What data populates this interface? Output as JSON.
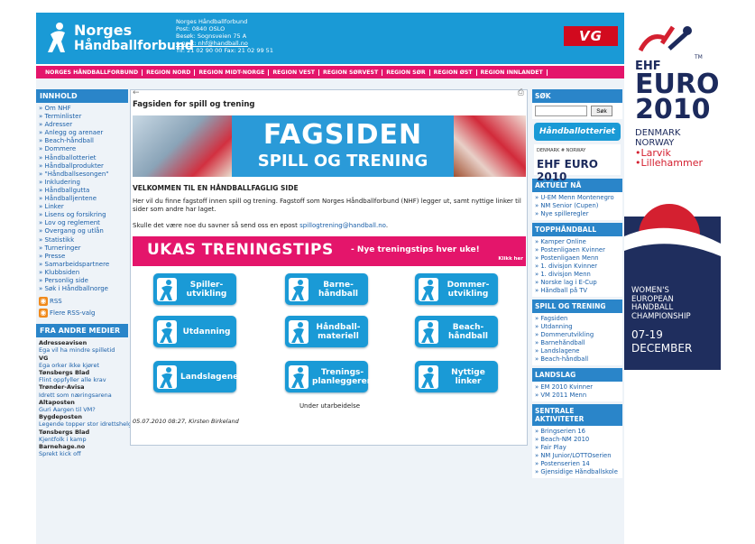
{
  "header": {
    "logo_line1": "Norges",
    "logo_line2": "Håndballforbund",
    "address": [
      "Norges Håndballforbund",
      "Post: 0840 OSLO",
      "Besøk: Sognsveien 75 A",
      "e-post: nhf@handball.no",
      "Tlf: 21 02 90 00 Fax: 21 02 99 51"
    ],
    "vg_logo": "VG"
  },
  "nav": [
    "NORGES HÅNDBALLFORBUND",
    "REGION NORD",
    "REGION MIDT-NORGE",
    "REGION VEST",
    "REGION SØRVEST",
    "REGION SØR",
    "REGION ØST",
    "REGION INNLANDET"
  ],
  "left": {
    "heading": "INNHOLD",
    "links": [
      "Om NHF",
      "Terminlister",
      "Adresser",
      "Anlegg og arenaer",
      "Beach-håndball",
      "Dommere",
      "Håndballotteriet",
      "Håndballprodukter",
      "\"Håndballsesongen\"",
      "Inkludering",
      "Håndballgutta",
      "Håndballjentene",
      "Linker",
      "Lisens og forsikring",
      "Lov og reglement",
      "Overgang og utlån",
      "Statistikk",
      "Turneringer",
      "Presse",
      "Samarbeidspartnere",
      "Klubbsiden",
      "Personlig side",
      "Søk i Håndballnorge"
    ],
    "rss": "RSS",
    "rss_more": "Flere RSS-valg",
    "media_heading": "FRA ANDRE MEDIER",
    "media": [
      {
        "source": "Adresseavisen",
        "title": "Ega vil ha mindre spilletid"
      },
      {
        "source": "VG",
        "title": "Ega orker ikke kjøret"
      },
      {
        "source": "Tønsbergs Blad",
        "title": "Flint oppfyller alle krav"
      },
      {
        "source": "Trønder-Avisa",
        "title": "Idrett som næringsarena"
      },
      {
        "source": "Altaposten",
        "title": "Guri Aargen til VM?"
      },
      {
        "source": "Bygdeposten",
        "title": "Legende topper stor idrettshelg"
      },
      {
        "source": "Tønsbergs Blad",
        "title": "Kjentfolk i kamp"
      },
      {
        "source": "Barnehage.no",
        "title": "Sprekt kick off"
      }
    ]
  },
  "main": {
    "back_icon": "←",
    "print_icon": "⎙",
    "title": "Fagsiden for spill og trening",
    "banner_line1": "FAGSIDEN",
    "banner_line2": "SPILL OG TRENING",
    "heading": "VELKOMMEN TIL EN HÅNDBALLFAGLIG SIDE",
    "intro": "Her vil du finne fagstoff innen spill og trening. Fagstoff som Norges Håndballforbund (NHF) legger ut, samt nyttige linker til sider som andre har laget.",
    "more_prefix": "Skulle det være noe du savner så send oss en epost ",
    "more_email": "spillogtrening@handball.no",
    "more_suffix": ".",
    "ukas_title": "UKAS TRENINGSTIPS",
    "ukas_sub": "- Nye treningstips hver uke!",
    "ukas_click": "Klikk her",
    "tiles": [
      "Spiller-\nutvikling",
      "Barne-\nhåndball",
      "Dommer-\nutvikling",
      "Utdanning",
      "Håndball-\nmateriell",
      "Beach-\nhåndball",
      "Landslagene",
      "Trenings-\nplanleggeren",
      "Nyttige\nlinker"
    ],
    "under": "Under utarbeidelse",
    "signature": "05.07.2010 08:27, Kirsten Birkeland"
  },
  "right": {
    "search_heading": "SØK",
    "search_button": "Søk",
    "lotto": "Håndballotteriet",
    "ehf_small_top": "DENMARK # NORWAY",
    "ehf_small_main": "EHF EURO 2010",
    "aktuelt_heading": "AKTUELT NÅ",
    "aktuelt": [
      "U-EM Menn Montenegro",
      "NM Senior (Cupen)",
      "Nye spilleregler"
    ],
    "topp_heading": "TOPPHÅNDBALL",
    "topp": [
      "Kamper Online",
      "Postenligaen Kvinner",
      "Postenligaen Menn",
      "1. divisjon Kvinner",
      "1. divisjon Menn",
      "Norske lag i E-Cup",
      "Håndball på TV"
    ],
    "spill_heading": "SPILL OG TRENING",
    "spill": [
      "Fagsiden",
      "Utdanning",
      "Dommerutvikling",
      "Barnehåndball",
      "Landslagene",
      "Beach-håndball"
    ],
    "lands_heading": "LANDSLAG",
    "lands": [
      "EM 2010 Kvinner",
      "VM 2011 Menn"
    ],
    "sentrale_heading": "SENTRALE AKTIVITETER",
    "sentrale": [
      "Bringserien 16",
      "Beach-NM 2010",
      "Fair Play",
      "NM Junior/LOTTOserien",
      "Postenserien 14",
      "Gjensidige Håndballskole"
    ]
  },
  "ad": {
    "ehf": "EHF",
    "euro": "EURO",
    "year": "2010",
    "tm": "TM",
    "denmark": "DENMARK",
    "norway": "NORWAY",
    "city1": "•Larvik",
    "city2": "•Lillehammer",
    "women": [
      "WOMEN'S",
      "EUROPEAN",
      "HANDBALL",
      "CHAMPIONSHIP"
    ],
    "dates": [
      "07-19",
      "DECEMBER"
    ]
  }
}
